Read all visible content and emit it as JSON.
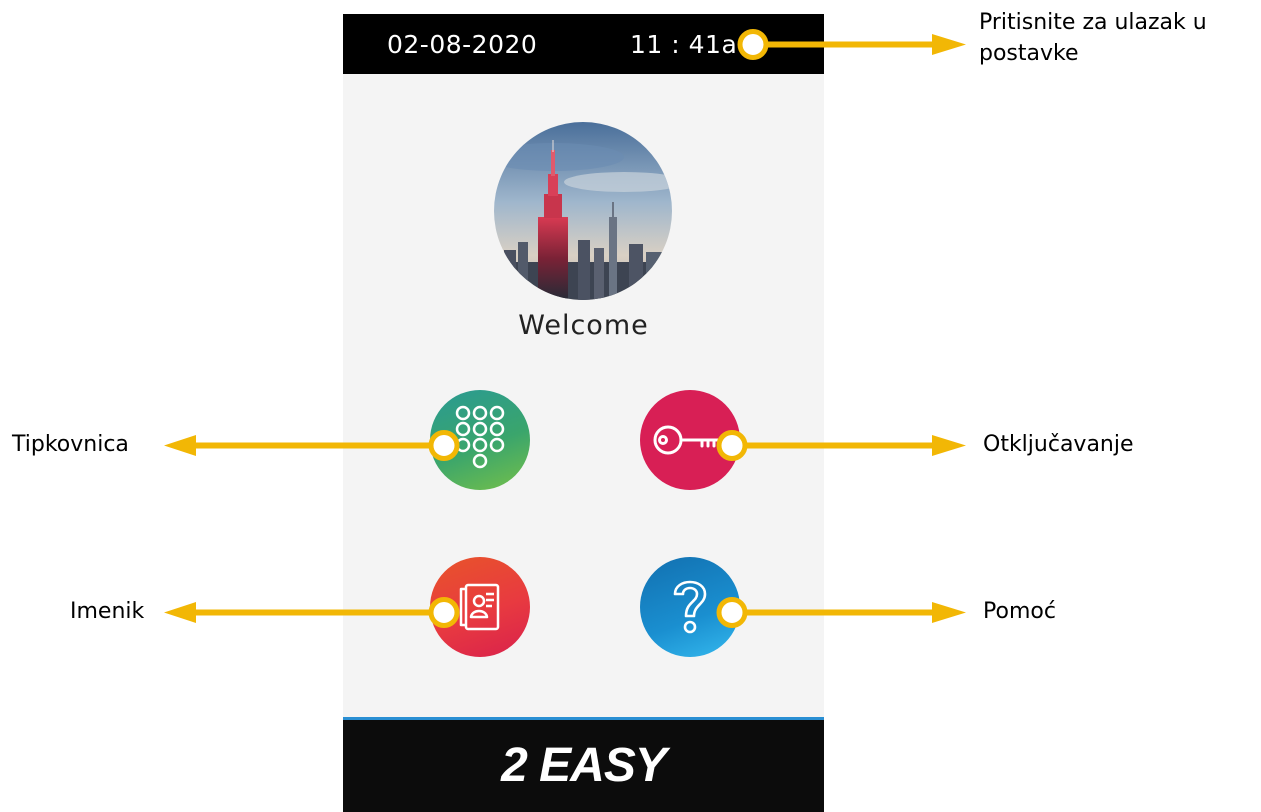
{
  "status_bar": {
    "date": "02-08-2020",
    "time": "11 : 41a"
  },
  "home": {
    "welcome_text": "Welcome"
  },
  "buttons": [
    {
      "id": "keypad",
      "icon": "keypad-icon",
      "color": "#3aa56c"
    },
    {
      "id": "unlock",
      "icon": "key-icon",
      "color": "#d81f55"
    },
    {
      "id": "directory",
      "icon": "contact-card-icon",
      "color": "#e83a40"
    },
    {
      "id": "help",
      "icon": "question-mark-icon",
      "color": "#1a8fd0"
    }
  ],
  "footer": {
    "brand": "2 EASY",
    "accent_color": "#2a8fd3"
  },
  "callouts": {
    "settings": "Pritisnite za ulazak u postavke",
    "keypad": "Tipkovnica",
    "unlock": "Otključavanje",
    "directory": "Imenik",
    "help": "Pomoć",
    "arrow_color": "#f2b705"
  }
}
